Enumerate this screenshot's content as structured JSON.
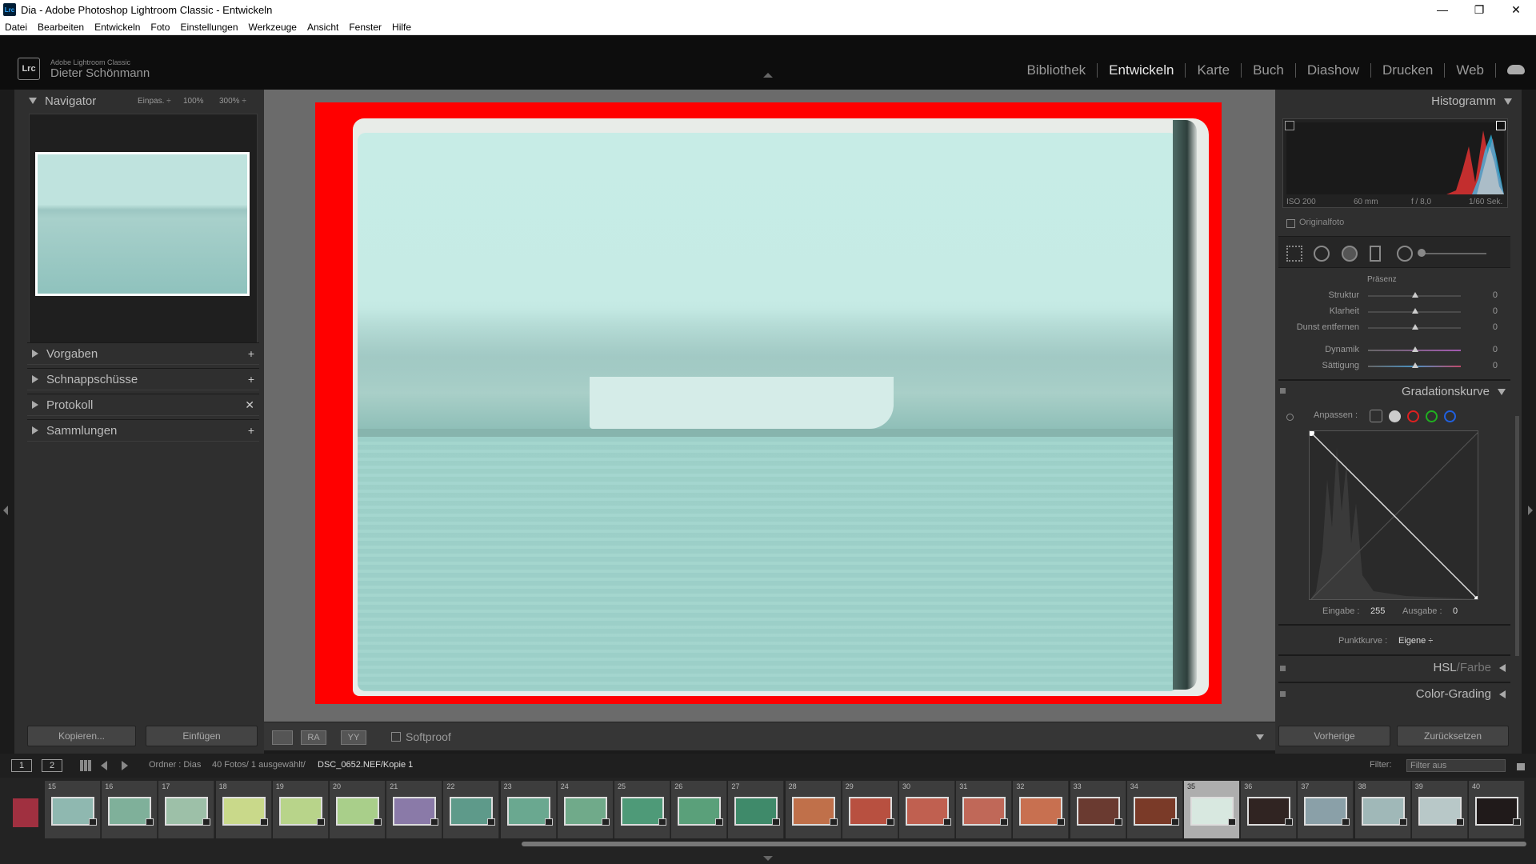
{
  "window": {
    "title": "Dia - Adobe Photoshop Lightroom Classic - Entwickeln",
    "app_icon": "Lrc",
    "controls": [
      "—",
      "❐",
      "✕"
    ]
  },
  "menu": [
    "Datei",
    "Bearbeiten",
    "Entwickeln",
    "Foto",
    "Einstellungen",
    "Werkzeuge",
    "Ansicht",
    "Fenster",
    "Hilfe"
  ],
  "identity": {
    "logo": "Lrc",
    "brand": "Adobe Lightroom Classic",
    "user": "Dieter Schönmann"
  },
  "modules": {
    "items": [
      "Bibliothek",
      "Entwickeln",
      "Karte",
      "Buch",
      "Diashow",
      "Drucken",
      "Web"
    ],
    "active": "Entwickeln"
  },
  "left_panel": {
    "navigator": {
      "title": "Navigator",
      "zoom_fit": "Einpas. ÷",
      "zoom_100": "100%",
      "zoom_300": "300% ÷"
    },
    "sections": [
      {
        "label": "Vorgaben",
        "action": "+"
      },
      {
        "label": "Schnappschüsse",
        "action": "+"
      },
      {
        "label": "Protokoll",
        "action": "✕"
      },
      {
        "label": "Sammlungen",
        "action": "+"
      }
    ],
    "copy_button": "Kopieren...",
    "paste_button": "Einfügen"
  },
  "toolbar": {
    "view_before": "RA",
    "view_after": "YY",
    "softproof_label": "Softproof"
  },
  "right_panel": {
    "histogram": {
      "title": "Histogramm",
      "iso": "ISO 200",
      "focal": "60 mm",
      "aperture": "f / 8,0",
      "shutter": "1/60 Sek.",
      "original_label": "Originalfoto"
    },
    "presence": {
      "title": "Präsenz",
      "sliders": [
        {
          "label": "Struktur",
          "value": "0"
        },
        {
          "label": "Klarheit",
          "value": "0"
        },
        {
          "label": "Dunst entfernen",
          "value": "0"
        },
        {
          "label": "Dynamik",
          "value": "0"
        },
        {
          "label": "Sättigung",
          "value": "0"
        }
      ]
    },
    "tone_curve": {
      "title": "Gradationskurve",
      "adjust_label": "Anpassen :",
      "input_label": "Eingabe :",
      "input_value": "255",
      "output_label": "Ausgabe :",
      "output_value": "0",
      "point_curve_label": "Punktkurve :",
      "point_curve_value": "Eigene ÷",
      "channel_colors": [
        "#cccccc",
        "#e02020",
        "#20b020",
        "#2060e0"
      ]
    },
    "hsl": {
      "title": "HSL",
      "sep": " / ",
      "sub": "Farbe"
    },
    "color_grading": {
      "title": "Color-Grading"
    },
    "prev_button": "Vorherige",
    "reset_button": "Zurücksetzen"
  },
  "filmstrip_header": {
    "screen1": "1",
    "screen2": "2",
    "source": "Ordner : Dias",
    "count": "40 Fotos/ 1 ausgewählt/",
    "file": "DSC_0652.NEF/Kopie 1",
    "filter_label": "Filter:",
    "filter_value": "Filter aus"
  },
  "filmstrip": {
    "cells": [
      {
        "num": "15",
        "tone": "#8fb8b0"
      },
      {
        "num": "16",
        "tone": "#7fb09a"
      },
      {
        "num": "17",
        "tone": "#9dc0a8"
      },
      {
        "num": "18",
        "tone": "#c9d98a"
      },
      {
        "num": "19",
        "tone": "#b8d48a"
      },
      {
        "num": "20",
        "tone": "#a9cf8a"
      },
      {
        "num": "21",
        "tone": "#8a7aa8"
      },
      {
        "num": "22",
        "tone": "#5e9a8a"
      },
      {
        "num": "23",
        "tone": "#6aa890"
      },
      {
        "num": "24",
        "tone": "#70aa8a"
      },
      {
        "num": "25",
        "tone": "#4e9a78"
      },
      {
        "num": "26",
        "tone": "#5aa07a"
      },
      {
        "num": "27",
        "tone": "#3f8a6a"
      },
      {
        "num": "28",
        "tone": "#c0704a"
      },
      {
        "num": "29",
        "tone": "#b85040"
      },
      {
        "num": "30",
        "tone": "#c06050"
      },
      {
        "num": "31",
        "tone": "#c06858"
      },
      {
        "num": "32",
        "tone": "#c87050"
      },
      {
        "num": "33",
        "tone": "#6a3a30"
      },
      {
        "num": "34",
        "tone": "#7a3a28"
      },
      {
        "num": "35",
        "tone": "#d8e8e0"
      },
      {
        "num": "36",
        "tone": "#302422"
      },
      {
        "num": "37",
        "tone": "#8aa0a8"
      },
      {
        "num": "38",
        "tone": "#a0b8b8"
      },
      {
        "num": "39",
        "tone": "#b8c8c8"
      },
      {
        "num": "40",
        "tone": "#201a1a"
      }
    ],
    "selected": "35"
  }
}
